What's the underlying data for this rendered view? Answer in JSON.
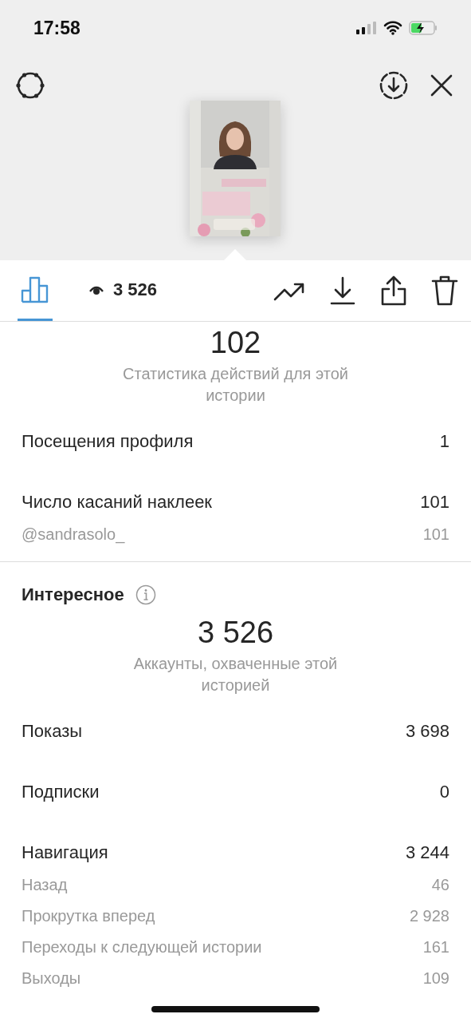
{
  "status_bar": {
    "time": "17:58"
  },
  "tabs": [
    {
      "kind": "insights",
      "selected": true
    },
    {
      "kind": "views",
      "label": "3 526",
      "selected": false
    }
  ],
  "sections": [
    {
      "total": "102",
      "caption": "Статистика действий для этой истории",
      "rows": [
        {
          "kind": "main",
          "label": "Посещения профиля",
          "value": "1"
        },
        {
          "kind": "main",
          "label": "Число касаний наклеек",
          "value": "101"
        },
        {
          "kind": "sub",
          "label": "@sandrasolo_",
          "value": "101"
        }
      ]
    },
    {
      "title": "Интересное",
      "total": "3 526",
      "caption": "Аккаунты, охваченные этой историей",
      "rows": [
        {
          "kind": "main",
          "label": "Показы",
          "value": "3 698"
        },
        {
          "kind": "main",
          "label": "Подписки",
          "value": "0"
        },
        {
          "kind": "main",
          "label": "Навигация",
          "value": "3 244"
        },
        {
          "kind": "sub",
          "label": "Назад",
          "value": "46"
        },
        {
          "kind": "sub",
          "label": "Прокрутка вперед",
          "value": "2 928"
        },
        {
          "kind": "sub",
          "label": "Переходы к следующей истории",
          "value": "161"
        },
        {
          "kind": "sub",
          "label": "Выходы",
          "value": "109"
        }
      ]
    }
  ]
}
